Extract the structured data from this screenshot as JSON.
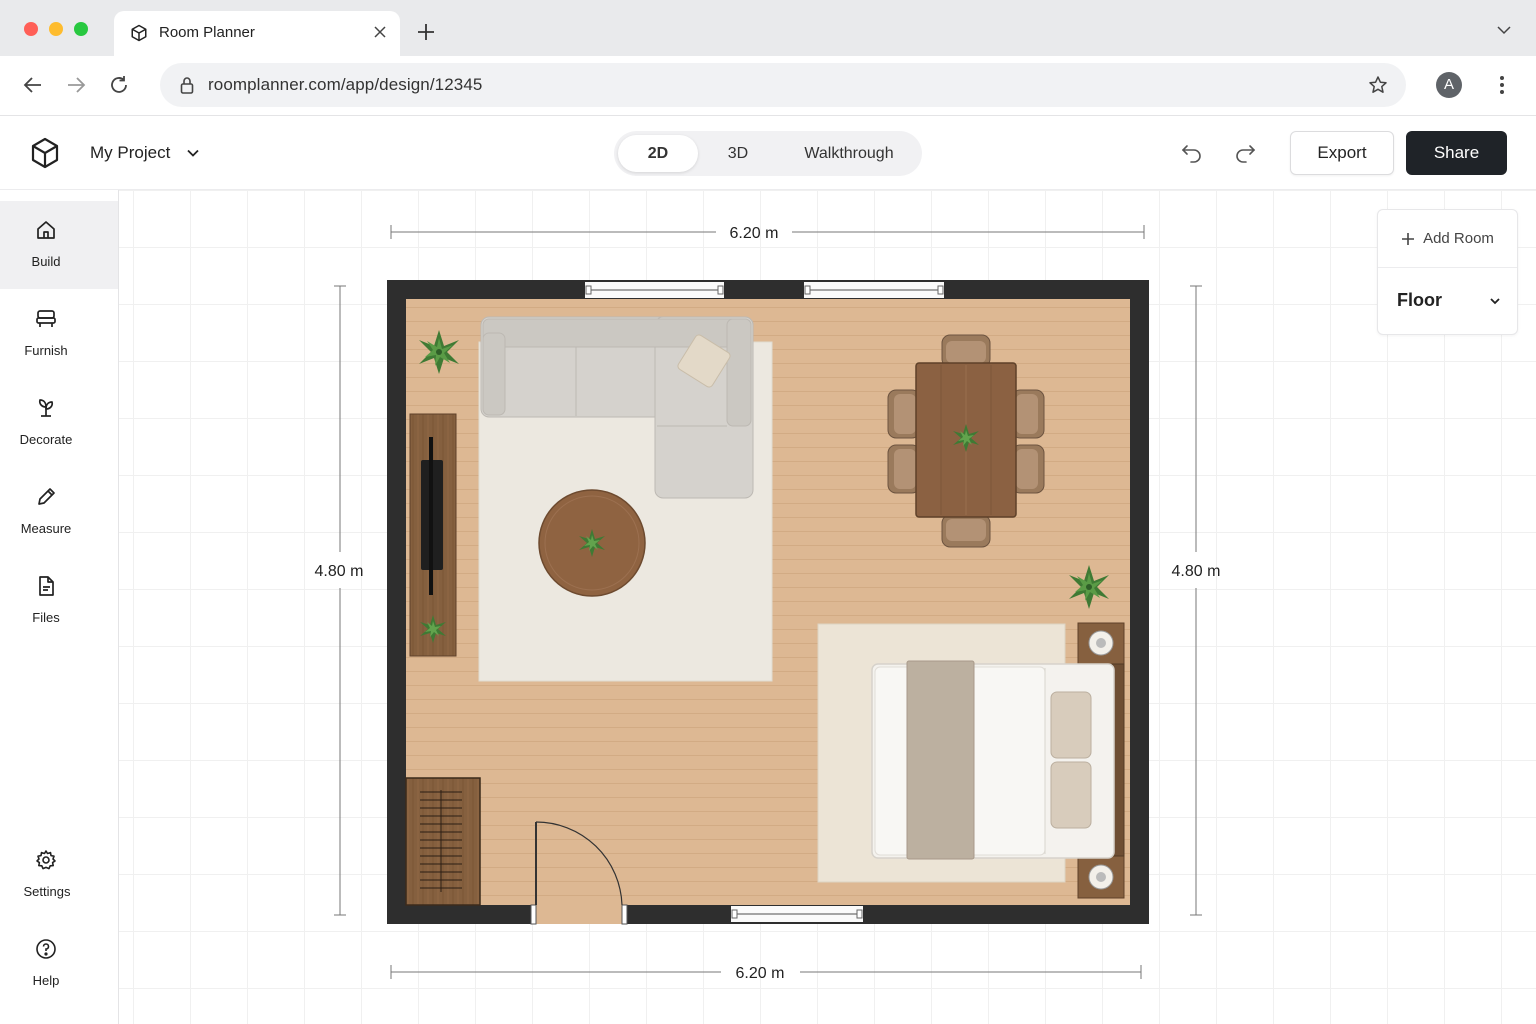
{
  "browser": {
    "tab_title": "Room Planner",
    "url": "roomplanner.com/app/design/12345",
    "profile_initial": "A"
  },
  "app": {
    "project_name": "My Project",
    "view_modes": [
      "2D",
      "3D",
      "Walkthrough"
    ],
    "active_view": "2D",
    "export_label": "Export",
    "share_label": "Share"
  },
  "sidebar": {
    "items": [
      {
        "label": "Build",
        "icon": "home-icon",
        "active": true
      },
      {
        "label": "Furnish",
        "icon": "chair-icon",
        "active": false
      },
      {
        "label": "Decorate",
        "icon": "plant-icon",
        "active": false
      },
      {
        "label": "Measure",
        "icon": "pencil-icon",
        "active": false
      },
      {
        "label": "Files",
        "icon": "file-icon",
        "active": false
      }
    ],
    "bottom_items": [
      {
        "label": "Settings",
        "icon": "gear-icon"
      },
      {
        "label": "Help",
        "icon": "help-icon"
      }
    ]
  },
  "panel": {
    "add_room_label": "Add Room",
    "floor_label": "Floor"
  },
  "plan": {
    "width_top": "6.20 m",
    "width_bottom": "6.20 m",
    "height_left": "4.80 m",
    "height_right": "4.80 m"
  },
  "colors": {
    "wall": "#2e2e2e",
    "floor": "#ddb893",
    "rug": "#ece8e0",
    "sofa": "#d5d2cd",
    "wood": "#8a5d3b",
    "plant": "#3f7a34",
    "accent_dark": "#1f2328"
  }
}
